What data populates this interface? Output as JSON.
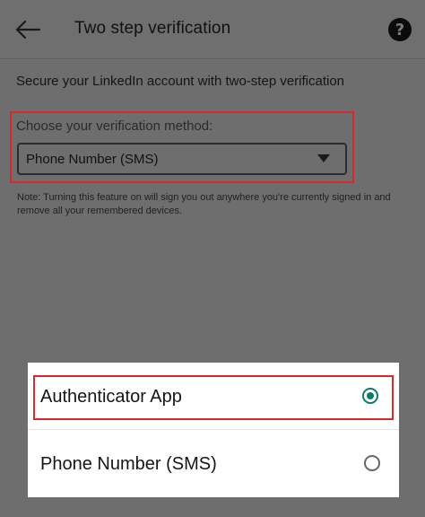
{
  "header": {
    "back_icon": "arrow-left-icon",
    "title": "Two step verification",
    "help_icon": "question-circle-icon",
    "help_glyph": "?"
  },
  "main": {
    "subtitle": "Secure your LinkedIn account with two-step verification",
    "method_label": "Choose your verification method:",
    "selected_method": "Phone Number (SMS)",
    "note": "Note: Turning this feature on will sign you out anywhere you're currently signed in and remove all your remembered devices."
  },
  "sheet": {
    "options": [
      {
        "label": "Authenticator App",
        "selected": true
      },
      {
        "label": "Phone Number (SMS)",
        "selected": false
      }
    ]
  },
  "colors": {
    "accent": "#0f7a6c",
    "highlight": "#d42a2a",
    "scrim": "#6e6e6e"
  }
}
